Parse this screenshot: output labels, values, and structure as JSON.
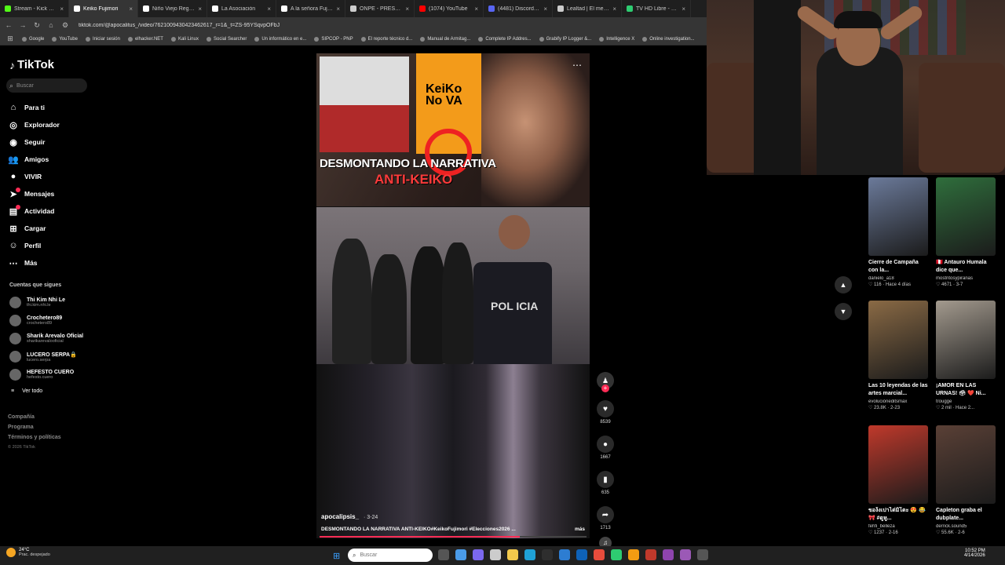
{
  "browser": {
    "tabs": [
      {
        "label": "Stream - Kick Dash",
        "color": "#53fc18",
        "active": false
      },
      {
        "label": "Keiko Fujimori",
        "color": "#fff",
        "active": true
      },
      {
        "label": "Niño Viejo Regala",
        "color": "#ffffff",
        "active": false
      },
      {
        "label": "La Asociación",
        "color": "#ffffff",
        "active": false
      },
      {
        "label": "A la señora Fujimori",
        "color": "#ffffff",
        "active": false
      },
      {
        "label": "ONPE - PRESENTAC",
        "color": "#cccccc",
        "active": false
      },
      {
        "label": "(1074) YouTube",
        "color": "#ff0000",
        "active": false
      },
      {
        "label": "(4481) Discord | #",
        "color": "#5865f2",
        "active": false
      },
      {
        "label": "Lealtad | El mejor s",
        "color": "#cccccc",
        "active": false
      },
      {
        "label": "TV HD Libre - Futb",
        "color": "#2ecc71",
        "active": false
      }
    ],
    "url": "tiktok.com/@apocalitus_/video/7621009430423462617_r=1&_t=ZS-95YSqvpOFbJ",
    "bookmarks": [
      "Google",
      "YouTube",
      "Iniciar sesión",
      "elhacker.NET",
      "Kali Linux",
      "Social Searcher",
      "Un informático en e...",
      "SIPCOP - PNP",
      "El reporte técnico d...",
      "Manual de Armitag...",
      "Complete IP Addres...",
      "Grabify IP Logger &...",
      "Intelligence X",
      "Online investigation..."
    ]
  },
  "sidebar": {
    "logo": "TikTok",
    "search_placeholder": "Buscar",
    "menu": [
      {
        "label": "Para ti",
        "icon": "home-icon",
        "glyph": "⌂",
        "badge": false
      },
      {
        "label": "Explorador",
        "icon": "compass-icon",
        "glyph": "◎",
        "badge": false
      },
      {
        "label": "Seguir",
        "icon": "following-icon",
        "glyph": "◉",
        "badge": false
      },
      {
        "label": "Amigos",
        "icon": "friends-icon",
        "glyph": "👥",
        "badge": false
      },
      {
        "label": "VIVIR",
        "icon": "live-icon",
        "glyph": "●",
        "badge": false
      },
      {
        "label": "Mensajes",
        "icon": "messages-icon",
        "glyph": "➤",
        "badge": true
      },
      {
        "label": "Actividad",
        "icon": "activity-icon",
        "glyph": "▤",
        "badge": true
      },
      {
        "label": "Cargar",
        "icon": "upload-icon",
        "glyph": "⊞",
        "badge": false
      },
      {
        "label": "Perfil",
        "icon": "profile-icon",
        "glyph": "☺",
        "badge": false
      },
      {
        "label": "Más",
        "icon": "more-icon",
        "glyph": "⋯",
        "badge": false
      }
    ],
    "following_title": "Cuentas que sigues",
    "following": [
      {
        "name": "Thi Kim Nhi Le",
        "handle": "thi.kim.nhi.le"
      },
      {
        "name": "Crochetero89",
        "handle": "crochetero89"
      },
      {
        "name": "Sharik Arevalo Oficial",
        "handle": "sharikarevalooficial"
      },
      {
        "name": "LUCERO SERPA🔒",
        "handle": "lucero.serpa"
      },
      {
        "name": "HEFESTO CUERO",
        "handle": "hefesto.cuero"
      }
    ],
    "see_all": "Ver todo",
    "footer": [
      "Compañía",
      "Programa",
      "Términos y políticas"
    ],
    "copyright": "© 2026 TikTok"
  },
  "video": {
    "headline_1": "DESMONTANDO LA NARRATIVA",
    "headline_2": "ANTI-KEIKO",
    "keiko_text": "KeiKo\nNo VA",
    "vest_text": "POL ICIA",
    "author": "apocalipsis_",
    "date": "· 3-24",
    "description": "DESMONTANDO LA NARRATIVA ANTI-KEIKO#KeikoFujimori #Elecciones2026 ...",
    "more_label": "más",
    "progress": 0.75,
    "likes": "8539",
    "comments": "1667",
    "saves": "635",
    "shares": "1713"
  },
  "grid": [
    {
      "title": "Cierre de Campaña con la...",
      "author": "danielo_a18",
      "meta": "♡ 116 · Hace 4 días",
      "color": "#6b7a9a"
    },
    {
      "title": "🇵🇪 Antauro Humala dice que...",
      "author": "mostritosypiranas",
      "meta": "♡ 4671 · 3-7",
      "color": "#2f6e3c"
    },
    {
      "title": "Las 10 leyendas de las artes marcial...",
      "author": "evolucióneditsmax",
      "meta": "♡ 23.8K · 2-23",
      "color": "#8a6a45"
    },
    {
      "title": "¡AMOR EN LAS URNAS! 🗳 ❤️ Ni...",
      "author": "trougge",
      "meta": "♡ 2 mil · Hace 2...",
      "color": "#a39a8e"
    },
    {
      "title": "ของ้งเปาไต่มิโตะ 😍 😂 🎀 #ดูหู...",
      "author": "fehfi_belleza",
      "meta": "♡ 1237 · 2-16",
      "color": "#c0392b"
    },
    {
      "title": "Capleton graba el dubplate...",
      "author": "derrick.sound5",
      "meta": "♡ 55.6K · 2-6",
      "color": "#5a4036"
    }
  ],
  "taskbar": {
    "temp": "24°C",
    "condition": "Prac. despejado",
    "search_placeholder": "Buscar",
    "time": "10:52 PM",
    "date": "4/14/2026"
  }
}
